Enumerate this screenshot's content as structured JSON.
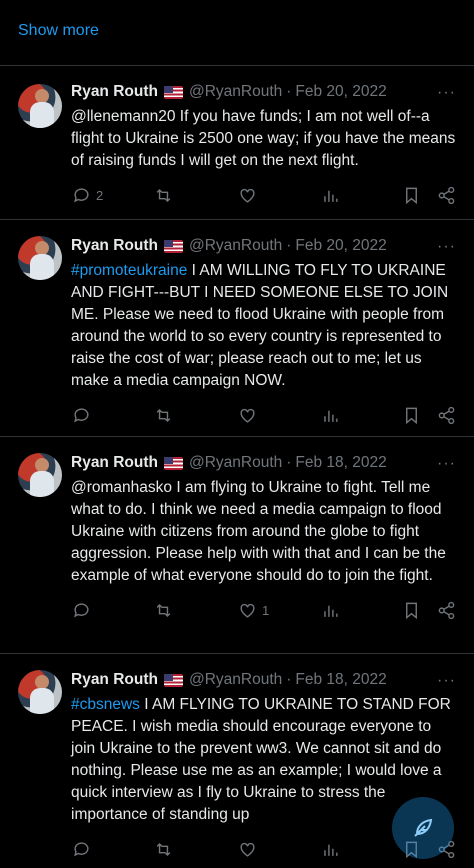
{
  "show_more": "Show more",
  "tweets": [
    {
      "name": "Ryan Routh",
      "handle": "@RyanRouth",
      "sep": "·",
      "date": "Feb 20, 2022",
      "tag": "",
      "text": "@llenemann20 If you have funds; I am not well of--a flight to Ukraine is 2500 one way; if you have the means of raising funds I will get on the next flight.",
      "replies": "2",
      "likes": ""
    },
    {
      "name": "Ryan Routh",
      "handle": "@RyanRouth",
      "sep": "·",
      "date": "Feb 20, 2022",
      "tag": "#promoteukraine",
      "text": " I AM WILLING TO FLY TO UKRAINE AND FIGHT---BUT I NEED SOMEONE ELSE TO JOIN ME. Please we need to flood Ukraine with people from around the world to so every country is represented to raise the cost of war; please reach out to me; let us make a media campaign NOW.",
      "replies": "",
      "likes": ""
    },
    {
      "name": "Ryan Routh",
      "handle": "@RyanRouth",
      "sep": "·",
      "date": "Feb 18, 2022",
      "tag": "",
      "text": "@romanhasko I am flying to Ukraine to fight.  Tell me what to do.  I think we need a media campaign to flood Ukraine with citizens from around the globe to fight aggression.  Please help with with that and I can be the example of what everyone should do to join the fight.",
      "replies": "",
      "likes": "1"
    },
    {
      "name": "Ryan Routh",
      "handle": "@RyanRouth",
      "sep": "·",
      "date": "Feb 18, 2022",
      "tag": "#cbsnews",
      "text": " I AM FLYING TO UKRAINE TO STAND FOR PEACE.  I wish media should encourage everyone to join Ukraine to the prevent ww3.  We cannot sit and do nothing.  Please use me as an example; I would love a quick interview as I fly to Ukraine to stress the importance of standing up",
      "replies": "",
      "likes": ""
    }
  ],
  "more_glyph": "···",
  "icons": [
    "reply-icon",
    "retweet-icon",
    "like-icon",
    "views-icon",
    "bookmark-icon",
    "share-icon",
    "compose-feather-icon"
  ],
  "colors": {
    "accent": "#1d9bf0",
    "muted": "#71767b",
    "text": "#e7e9ea",
    "background": "#000000"
  }
}
